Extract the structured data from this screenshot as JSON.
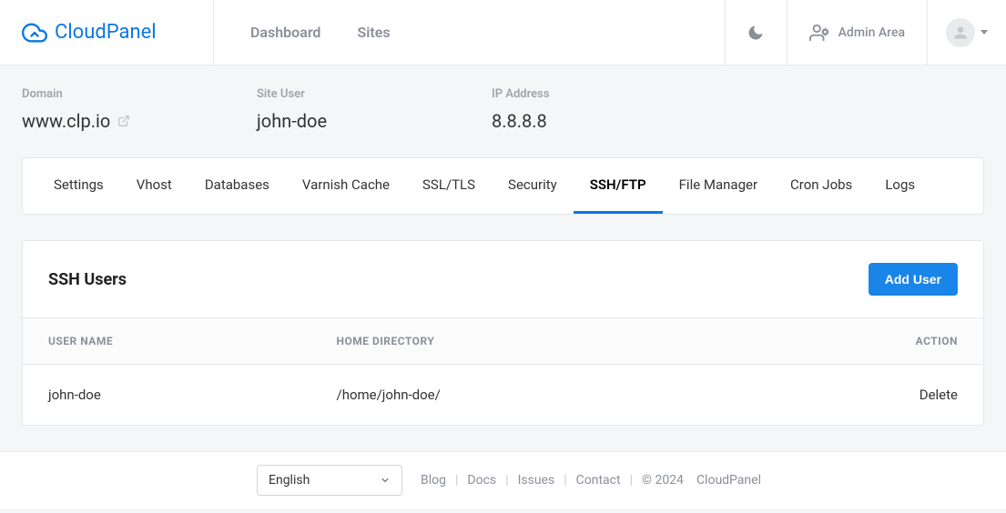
{
  "brand": {
    "name": "CloudPanel"
  },
  "nav": {
    "items": [
      {
        "label": "Dashboard"
      },
      {
        "label": "Sites"
      }
    ]
  },
  "header": {
    "admin_label": "Admin Area"
  },
  "info": {
    "domain_label": "Domain",
    "domain_value": "www.clp.io",
    "siteuser_label": "Site User",
    "siteuser_value": "john-doe",
    "ip_label": "IP Address",
    "ip_value": "8.8.8.8"
  },
  "tabs": [
    {
      "label": "Settings",
      "active": false
    },
    {
      "label": "Vhost",
      "active": false
    },
    {
      "label": "Databases",
      "active": false
    },
    {
      "label": "Varnish Cache",
      "active": false
    },
    {
      "label": "SSL/TLS",
      "active": false
    },
    {
      "label": "Security",
      "active": false
    },
    {
      "label": "SSH/FTP",
      "active": true
    },
    {
      "label": "File Manager",
      "active": false
    },
    {
      "label": "Cron Jobs",
      "active": false
    },
    {
      "label": "Logs",
      "active": false
    }
  ],
  "ssh_card": {
    "title": "SSH Users",
    "add_button": "Add User",
    "columns": {
      "username": "User Name",
      "homedir": "Home Directory",
      "action": "Action"
    },
    "rows": [
      {
        "username": "john-doe",
        "homedir": "/home/john-doe/",
        "action": "Delete"
      }
    ]
  },
  "footer": {
    "language": "English",
    "links": {
      "blog": "Blog",
      "docs": "Docs",
      "issues": "Issues",
      "contact": "Contact"
    },
    "copyright": "© 2024",
    "product": "CloudPanel"
  }
}
